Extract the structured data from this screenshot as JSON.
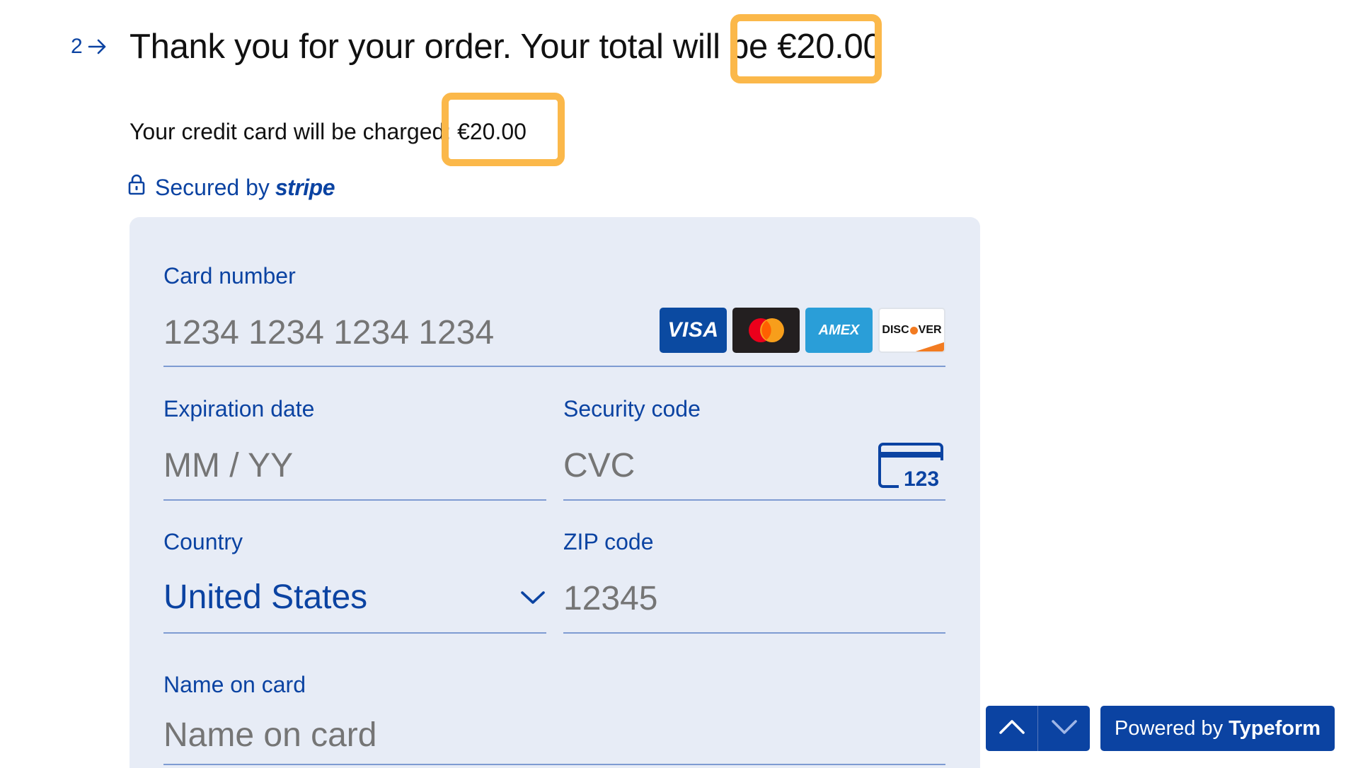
{
  "question": {
    "number": "2",
    "title_prefix": "Thank you for your order. Your total will be",
    "title_amount": "€20.00"
  },
  "charge": {
    "text_prefix": "Your credit card will be charged",
    "text_amount": ": €20.00"
  },
  "security": {
    "secured_by": "Secured by",
    "provider": "stripe"
  },
  "card_form": {
    "card_number": {
      "label": "Card number",
      "placeholder": "1234 1234 1234 1234"
    },
    "brands": {
      "visa": "VISA",
      "amex": "AMEX",
      "discover_a": "DISC",
      "discover_b": "VER"
    },
    "expiration": {
      "label": "Expiration date",
      "placeholder": "MM / YY"
    },
    "security_code": {
      "label": "Security code",
      "placeholder": "CVC",
      "icon_text": "123"
    },
    "country": {
      "label": "Country",
      "value": "United States"
    },
    "zip": {
      "label": "ZIP code",
      "placeholder": "12345"
    },
    "name_on_card": {
      "label": "Name on card",
      "placeholder": "Name on card"
    }
  },
  "footer": {
    "powered_by": "Powered by",
    "brand": "Typeform"
  },
  "colors": {
    "primary": "#0b43a2",
    "panel_bg": "#e7ecf6",
    "placeholder": "#a9bce0",
    "highlight": "#fbb84a"
  },
  "icons": [
    "arrow-right-icon",
    "lock-icon",
    "card-cvc-icon",
    "chevron-down-icon",
    "chevron-up-icon"
  ]
}
